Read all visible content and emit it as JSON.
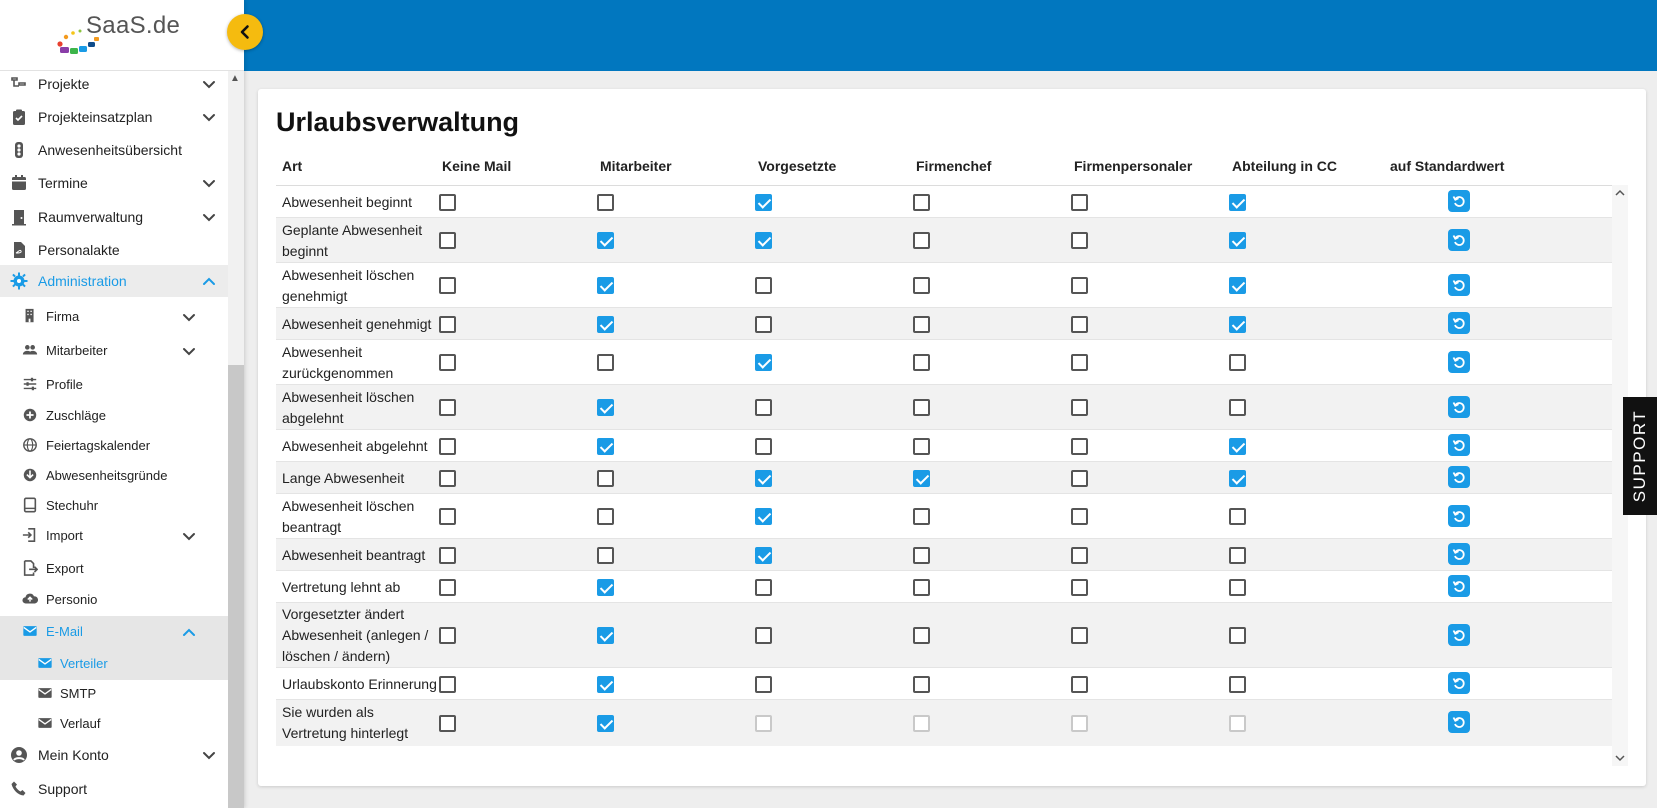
{
  "app": {
    "logo_text": "SaaS.de"
  },
  "sidebar": {
    "items": [
      {
        "label": "Projekte",
        "icon": "projects-icon",
        "level": 1,
        "chevron": "down"
      },
      {
        "label": "Projekteinsatzplan",
        "icon": "clipboard-check-icon",
        "level": 1,
        "chevron": "down"
      },
      {
        "label": "Anwesenheitsübersicht",
        "icon": "traffic-light-icon",
        "level": 1,
        "chevron": ""
      },
      {
        "label": "Termine",
        "icon": "calendar-icon",
        "level": 1,
        "chevron": "down"
      },
      {
        "label": "Raumverwaltung",
        "icon": "door-icon",
        "level": 1,
        "chevron": "down"
      },
      {
        "label": "Personalakte",
        "icon": "file-icon",
        "level": 1,
        "chevron": ""
      },
      {
        "label": "Administration",
        "icon": "gear-icon",
        "level": 1,
        "chevron": "up",
        "active": true
      },
      {
        "label": "Firma",
        "icon": "building-icon",
        "level": 2,
        "chevron": "down"
      },
      {
        "label": "Mitarbeiter",
        "icon": "users-icon",
        "level": 2,
        "chevron": "down"
      },
      {
        "label": "Profile",
        "icon": "sliders-icon",
        "level": 2,
        "chevron": ""
      },
      {
        "label": "Zuschläge",
        "icon": "plus-circle-icon",
        "level": 2,
        "chevron": ""
      },
      {
        "label": "Feiertagskalender",
        "icon": "globe-icon",
        "level": 2,
        "chevron": ""
      },
      {
        "label": "Abwesenheitsgründe",
        "icon": "arrow-down-circle-icon",
        "level": 2,
        "chevron": ""
      },
      {
        "label": "Stechuhr",
        "icon": "tablet-icon",
        "level": 2,
        "chevron": ""
      },
      {
        "label": "Import",
        "icon": "import-icon",
        "level": 2,
        "chevron": "down"
      },
      {
        "label": "Export",
        "icon": "export-icon",
        "level": 2,
        "chevron": ""
      },
      {
        "label": "Personio",
        "icon": "cloud-upload-icon",
        "level": 2,
        "chevron": ""
      },
      {
        "label": "E-Mail",
        "icon": "envelope-icon",
        "level": 2,
        "chevron": "up",
        "active": true
      },
      {
        "label": "Verteiler",
        "icon": "envelope-icon",
        "level": 3,
        "chevron": "",
        "active": true
      },
      {
        "label": "SMTP",
        "icon": "envelope-icon",
        "level": 3,
        "chevron": ""
      },
      {
        "label": "Verlauf",
        "icon": "envelope-icon",
        "level": 3,
        "chevron": ""
      },
      {
        "label": "Mein Konto",
        "icon": "user-circle-icon",
        "level": 1,
        "chevron": "down"
      },
      {
        "label": "Support",
        "icon": "phone-icon",
        "level": 1,
        "chevron": ""
      }
    ]
  },
  "main": {
    "title": "Urlaubsverwaltung",
    "columns": [
      "Art",
      "Keine Mail",
      "Mitarbeiter",
      "Vorgesetzte",
      "Firmenchef",
      "Firmenpersonaler",
      "Abteilung in CC",
      "auf Standardwert"
    ],
    "rows": [
      {
        "art": "Abwesenheit beginnt",
        "vals": [
          0,
          0,
          1,
          0,
          0,
          1
        ]
      },
      {
        "art": "Geplante Abwesenheit beginnt",
        "vals": [
          0,
          1,
          1,
          0,
          0,
          1
        ]
      },
      {
        "art": "Abwesenheit löschen genehmigt",
        "vals": [
          0,
          1,
          0,
          0,
          0,
          1
        ]
      },
      {
        "art": "Abwesenheit genehmigt",
        "vals": [
          0,
          1,
          0,
          0,
          0,
          1
        ]
      },
      {
        "art": "Abwesenheit zurückgenommen",
        "vals": [
          0,
          0,
          1,
          0,
          0,
          0
        ]
      },
      {
        "art": "Abwesenheit löschen abgelehnt",
        "vals": [
          0,
          1,
          0,
          0,
          0,
          0
        ]
      },
      {
        "art": "Abwesenheit abgelehnt",
        "vals": [
          0,
          1,
          0,
          0,
          0,
          1
        ]
      },
      {
        "art": "Lange Abwesenheit",
        "vals": [
          0,
          0,
          1,
          1,
          0,
          1
        ]
      },
      {
        "art": "Abwesenheit löschen beantragt",
        "vals": [
          0,
          0,
          1,
          0,
          0,
          0
        ]
      },
      {
        "art": "Abwesenheit beantragt",
        "vals": [
          0,
          0,
          1,
          0,
          0,
          0
        ]
      },
      {
        "art": "Vertretung lehnt ab",
        "vals": [
          0,
          1,
          0,
          0,
          0,
          0
        ]
      },
      {
        "art": "Vorgesetzter ändert Abwesenheit (anlegen / löschen / ändern)",
        "vals": [
          0,
          1,
          0,
          0,
          0,
          0
        ]
      },
      {
        "art": "Urlaubskonto Erinnerung",
        "vals": [
          0,
          1,
          0,
          0,
          0,
          0
        ]
      },
      {
        "art": "Sie wurden als Vertretung hinterlegt",
        "vals": [
          0,
          1,
          2,
          2,
          2,
          2
        ]
      }
    ]
  },
  "support_tab": {
    "label": "SUPPORT"
  },
  "colors": {
    "topbar": "#0177bf",
    "accent": "#1a9be6",
    "toggle": "#f5bb0f"
  }
}
